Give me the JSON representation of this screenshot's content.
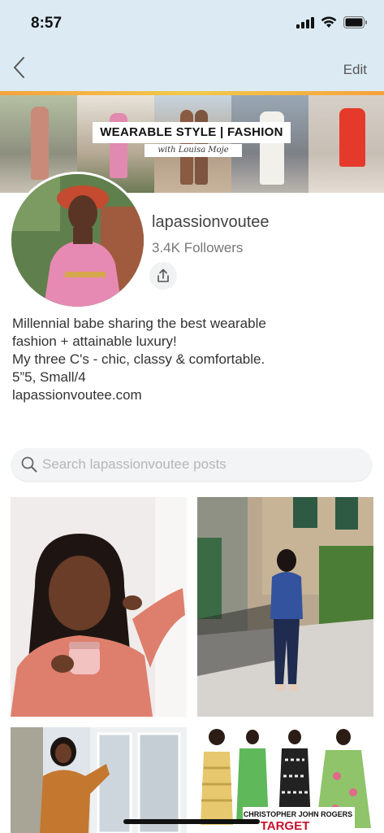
{
  "status_bar": {
    "time": "8:57"
  },
  "nav": {
    "back_icon": "chevron-left-icon",
    "edit_label": "Edit"
  },
  "banner": {
    "title": "WEARABLE STYLE | FASHION FINDS",
    "subtitle": "with Louisa Moje"
  },
  "profile": {
    "username": "lapassionvoutee",
    "followers": "3.4K Followers",
    "share_icon": "share-icon"
  },
  "bio": {
    "lines": [
      "Millennial babe sharing the best wearable",
      "fashion + attainable luxury!",
      "My three C's - chic, classy & comfortable.",
      "5”5, Small/4",
      "lapassionvoutee.com"
    ]
  },
  "search": {
    "placeholder": "Search lapassionvoutee posts",
    "icon": "search-icon"
  },
  "posts": {
    "tile4_caption_line1": "CHRISTOPHER JOHN ROGERS",
    "tile4_caption_line2": "TARGET"
  },
  "colors": {
    "header_bg": "#dcebf3",
    "accent": "#f2c94c"
  }
}
